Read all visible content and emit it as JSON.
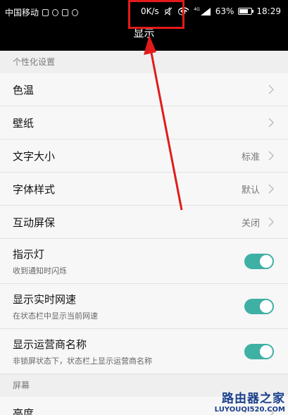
{
  "status_bar": {
    "carrier": "中国移动",
    "net_speed": "0K/s",
    "battery": "63%",
    "time": "18:29",
    "network_type": "4G"
  },
  "title": "显示",
  "sections": [
    {
      "header": "个性化设置",
      "rows": [
        {
          "label": "色温",
          "value": "",
          "type": "chevron"
        },
        {
          "label": "壁纸",
          "value": "",
          "type": "chevron"
        },
        {
          "label": "文字大小",
          "value": "标准",
          "type": "chevron"
        },
        {
          "label": "字体样式",
          "value": "默认",
          "type": "chevron"
        },
        {
          "label": "互动屏保",
          "value": "关闭",
          "type": "chevron"
        },
        {
          "label": "指示灯",
          "sub": "收到通知时闪烁",
          "type": "toggle",
          "on": true
        },
        {
          "label": "显示实时网速",
          "sub": "在状态栏中显示当前网速",
          "type": "toggle",
          "on": true
        },
        {
          "label": "显示运营商名称",
          "sub": "非锁屏状态下，状态栏上显示运营商名称",
          "type": "toggle",
          "on": true
        }
      ]
    },
    {
      "header": "屏幕",
      "rows": [
        {
          "label": "亮度",
          "value": "",
          "type": "chevron"
        }
      ]
    }
  ],
  "watermark": {
    "title": "路由器之家",
    "url": "LUYOUQI520.COM"
  },
  "colors": {
    "toggle_on": "#3fb0a4",
    "annotation_red": "#e21a1a"
  }
}
